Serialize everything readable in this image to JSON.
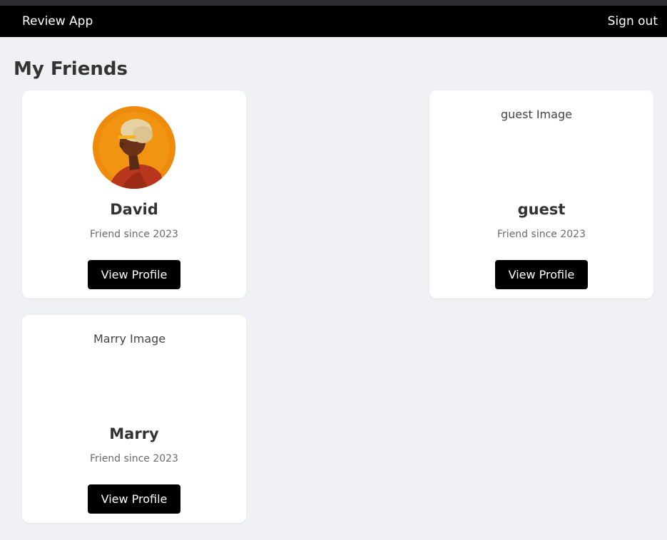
{
  "navbar": {
    "brand": "Review App",
    "sign_out": "Sign out"
  },
  "page": {
    "title": "My Friends"
  },
  "friends": [
    {
      "name": "David",
      "image": "avatar-photo",
      "since": "Friend since 2023",
      "button": "View Profile"
    },
    {
      "name": "guest",
      "image_alt": "guest Image",
      "since": "Friend since 2023",
      "button": "View Profile"
    },
    {
      "name": "Marry",
      "image_alt": "Marry Image",
      "since": "Friend since 2023",
      "button": "View Profile"
    }
  ],
  "colors": {
    "background": "#eff1f5",
    "navbar": "#000000",
    "button": "#000000",
    "card": "#ffffff"
  }
}
